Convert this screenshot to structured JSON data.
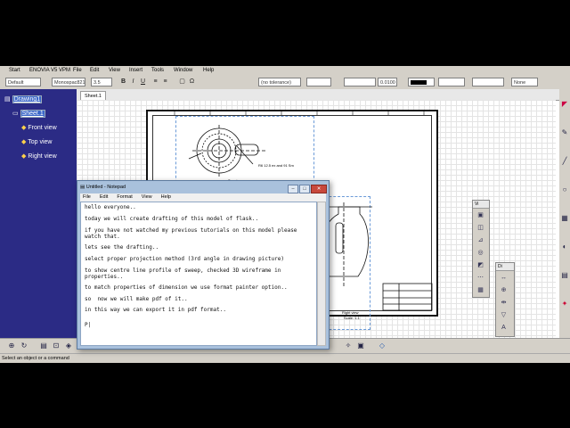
{
  "menubar": {
    "start": "Start",
    "enovia": "ENOVIA V5 VPM",
    "file": "File",
    "edit": "Edit",
    "view": "View",
    "insert": "Insert",
    "tools": "Tools",
    "window": "Window",
    "help": "Help"
  },
  "toolbar": {
    "style": "Default",
    "font": "Monospac821",
    "font_size": "3.5",
    "tolerance": "(no tolerance)",
    "precision": "0.0100",
    "line_none": "None"
  },
  "tree": {
    "root": "Drawing1",
    "sheet": "Sheet.1",
    "views": [
      "Front view",
      "Top view",
      "Right view"
    ]
  },
  "tabs": {
    "sheet": "Sheet.1"
  },
  "drawing": {
    "dim_label": "R6 12.5 ex and 91 Sm",
    "top_view_label": "Top view",
    "right_view_label": "Right view",
    "scale_label": "Scale: 1:1"
  },
  "palettes": {
    "views": "Vi",
    "dim": "Di"
  },
  "notepad": {
    "title": "Untitled - Notepad",
    "menu": [
      "File",
      "Edit",
      "Format",
      "View",
      "Help"
    ],
    "lines": [
      "hello everyone..",
      "today we will create drafting of this model of flask..",
      "if you have not watched my previous tutorials on this model please",
      "watch that.",
      "lets see the drafting..",
      "select proper projection method (3rd angle in drawing picture)",
      "to show centre line profile of sweep, checked 3D wireframe in",
      "properties..",
      "to match properties of dimension we use format painter option..",
      "so  now we will make pdf of it..",
      "in this way we can export it in pdf format..",
      "P|"
    ]
  },
  "status": "Select an object or a command"
}
